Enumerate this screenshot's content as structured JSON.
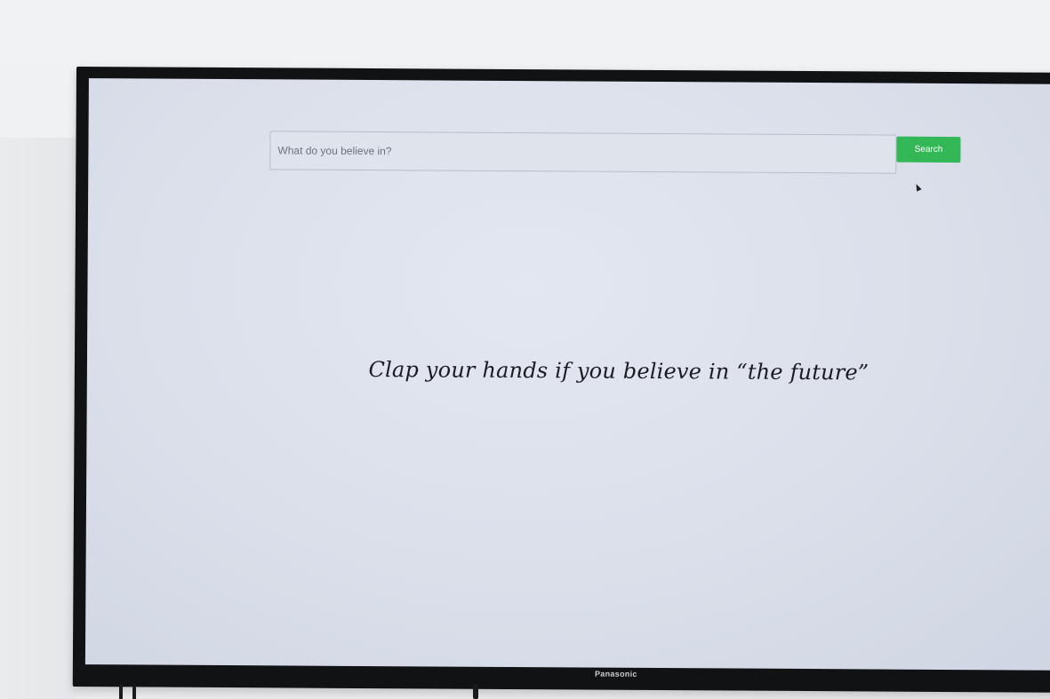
{
  "search": {
    "placeholder": "What do you believe in?",
    "value": "",
    "button_label": "Search",
    "button_color": "#34b757"
  },
  "main": {
    "headline": "Clap your hands if you believe in “the future”"
  },
  "device": {
    "brand": "Panasonic"
  }
}
